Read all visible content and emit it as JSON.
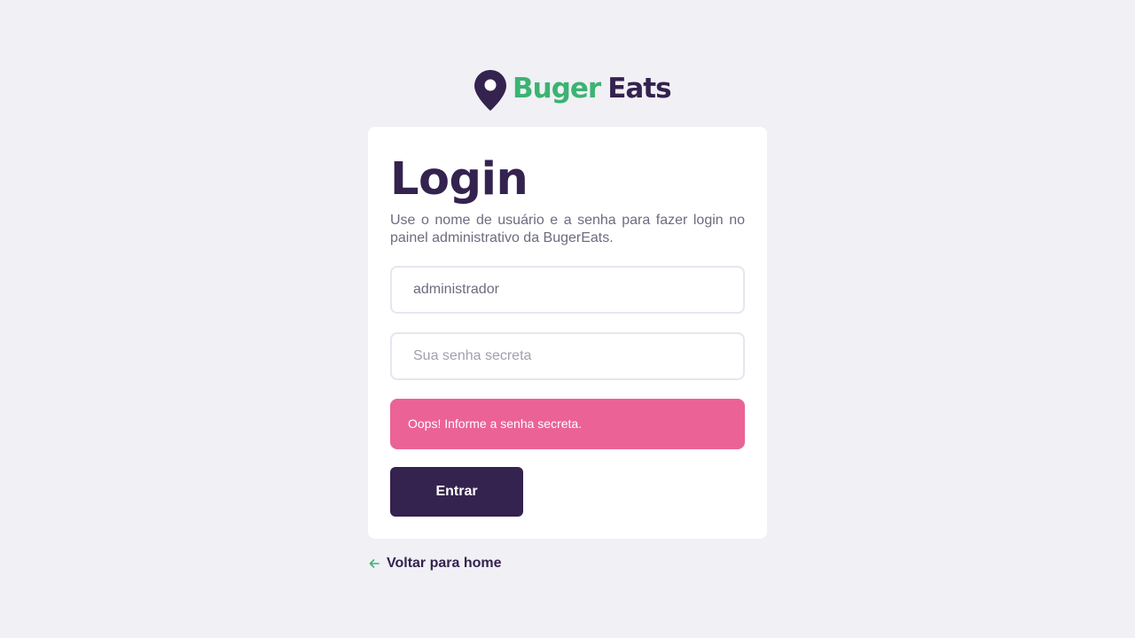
{
  "logo": {
    "part1": "Buger",
    "part2": "Eats"
  },
  "login": {
    "title": "Login",
    "description": "Use o nome de usuário e a senha para fazer login no painel administrativo da BugerEats.",
    "username_value": "administrador",
    "password_placeholder": "Sua senha secreta",
    "error_message": "Oops! Informe a senha secreta.",
    "submit_label": "Entrar"
  },
  "footer": {
    "back_label": "Voltar para home"
  },
  "colors": {
    "background": "#F0F0F5",
    "brand_purple": "#34224F",
    "brand_green": "#3CB371",
    "error_pink": "#EB6296",
    "text_muted": "#6C6C80"
  },
  "icons": {
    "logo": "location-pin-icon",
    "back": "arrow-left-icon"
  }
}
